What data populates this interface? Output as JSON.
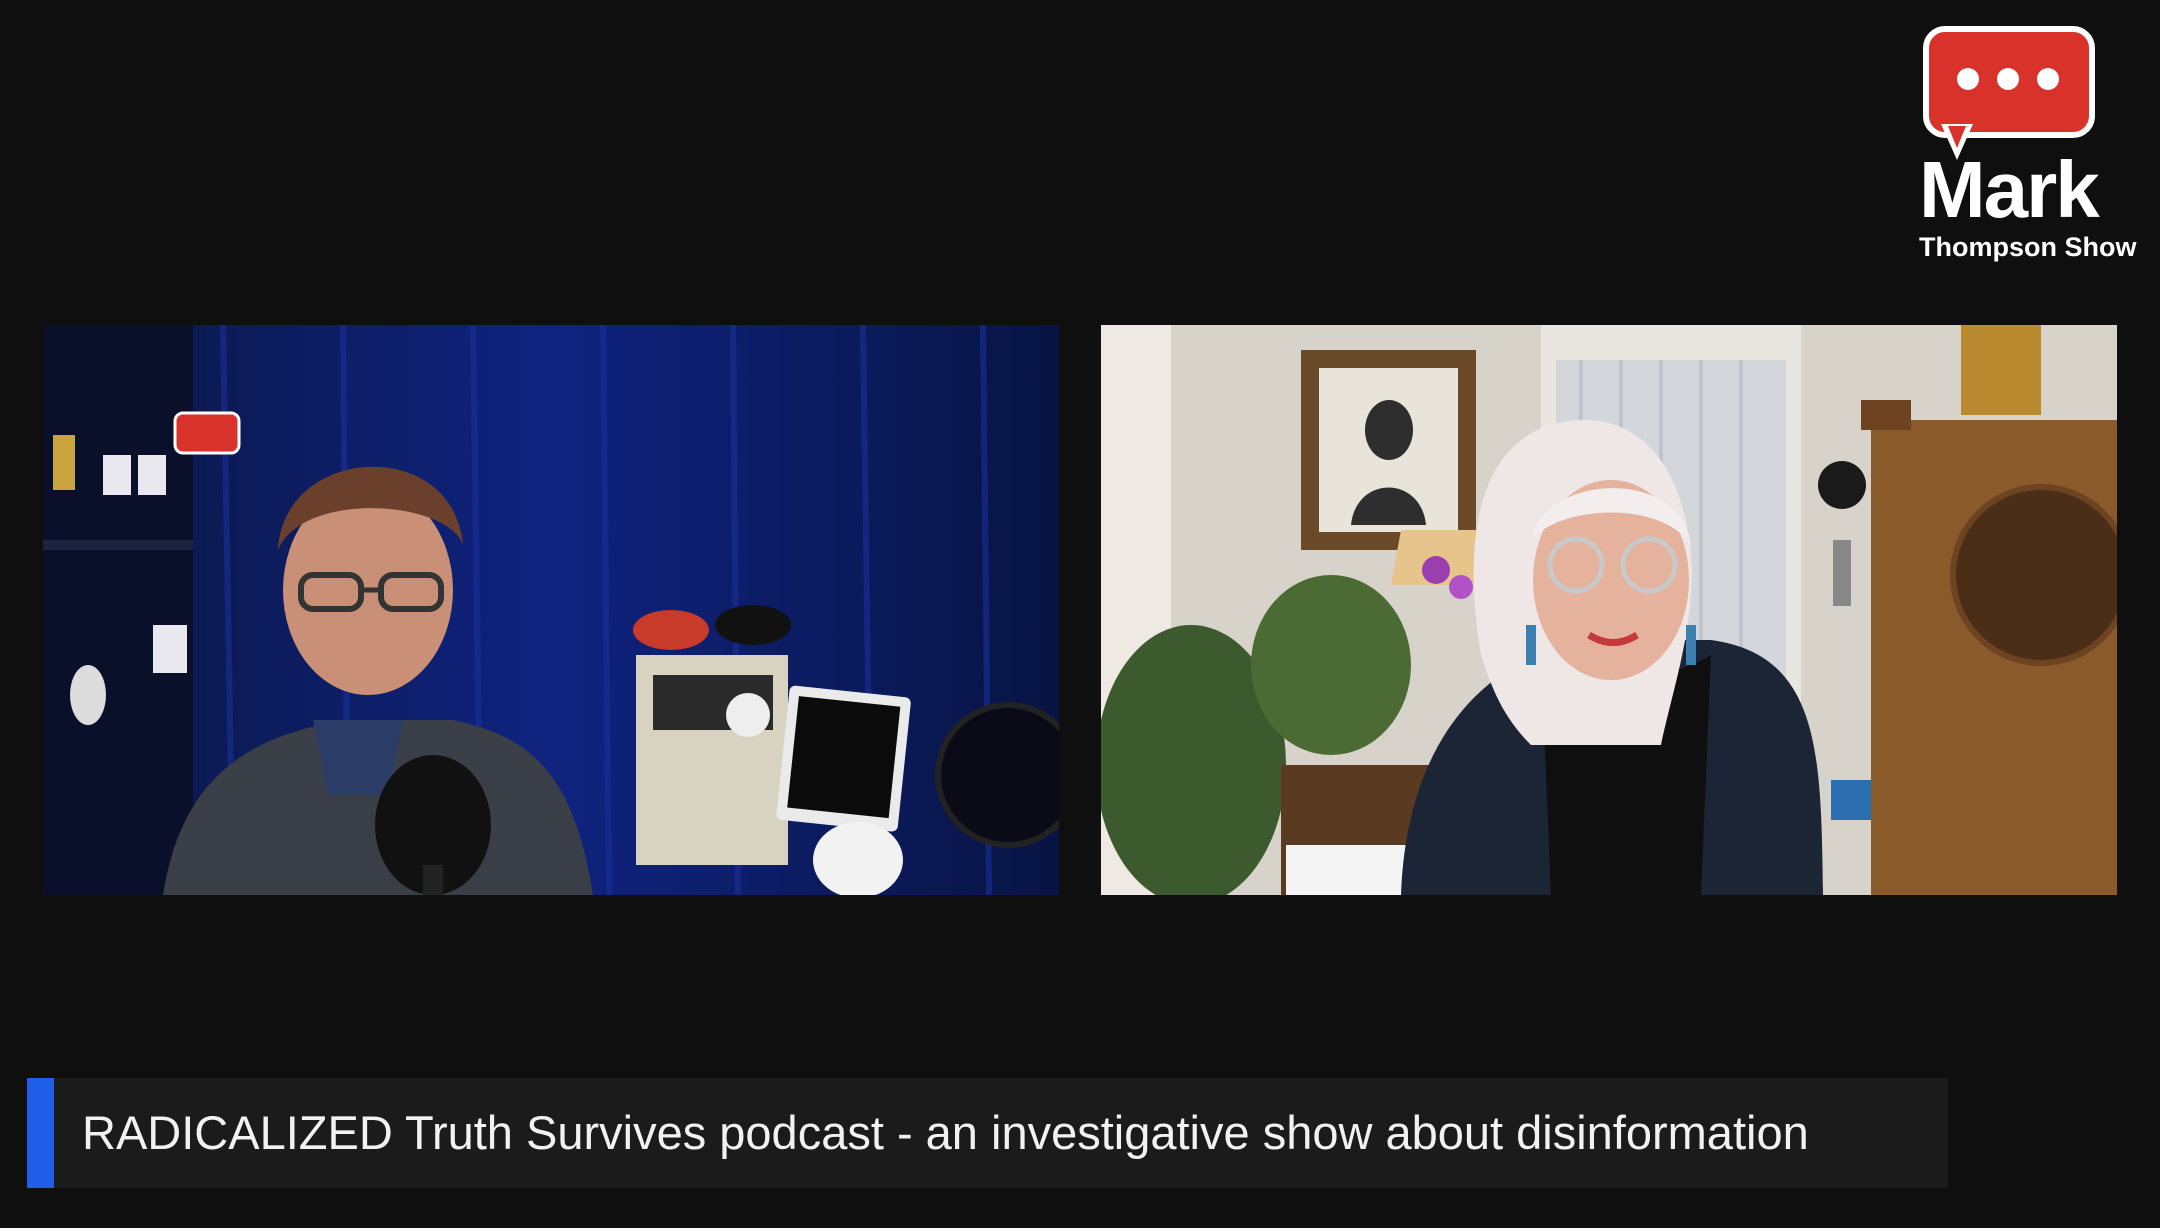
{
  "logo": {
    "name": "Mark",
    "subtitle": "Thompson Show",
    "bubble_color": "#d9322b",
    "icon": "speech-bubble-icon"
  },
  "video": {
    "left_participant": {
      "backdrop": "blue curtain studio",
      "backdrop_color": "#0a1a58"
    },
    "right_participant": {
      "backdrop": "home living room",
      "backdrop_color": "#cfc8bd"
    }
  },
  "caption": {
    "text": "RADICALIZED Truth Survives podcast - an investigative show about disinformation",
    "accent_color": "#1f5fe8"
  }
}
